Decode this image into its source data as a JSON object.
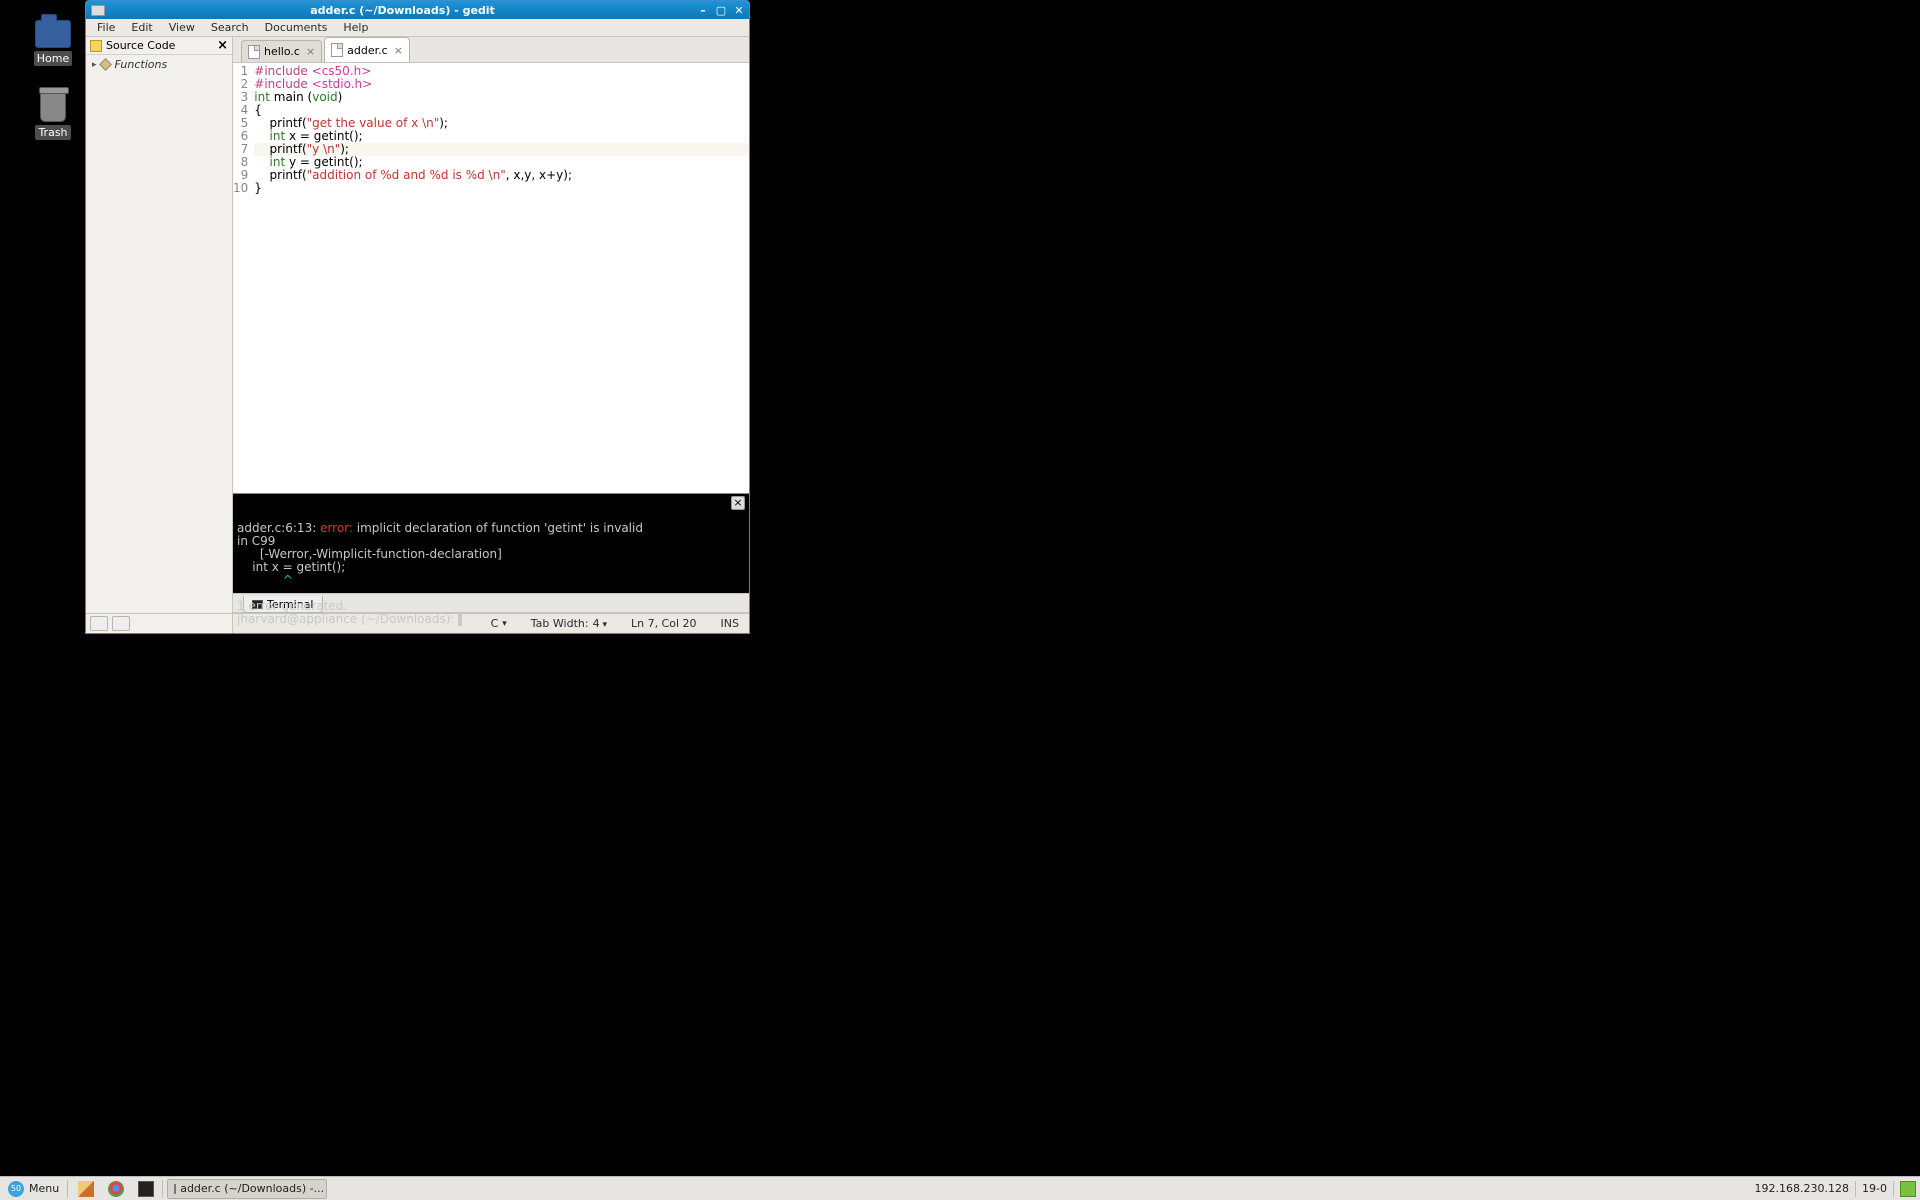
{
  "desktop": {
    "icons": [
      {
        "label": "Home"
      },
      {
        "label": "Trash"
      }
    ]
  },
  "window": {
    "title": "adder.c (~/Downloads) - gedit",
    "menus": [
      "File",
      "Edit",
      "View",
      "Search",
      "Documents",
      "Help"
    ]
  },
  "sidebar": {
    "title": "Source Code",
    "functions": "Functions"
  },
  "tabs": [
    {
      "label": "hello.c",
      "active": false
    },
    {
      "label": "adder.c",
      "active": true
    }
  ],
  "code": {
    "lines": [
      {
        "n": "1",
        "html": [
          {
            "c": "pre",
            "t": "#include"
          },
          {
            "c": "",
            "t": " "
          },
          {
            "c": "inc",
            "t": "<cs50.h>"
          }
        ]
      },
      {
        "n": "2",
        "html": [
          {
            "c": "pre",
            "t": "#include"
          },
          {
            "c": "",
            "t": " "
          },
          {
            "c": "inc",
            "t": "<stdio.h>"
          }
        ]
      },
      {
        "n": "3",
        "html": [
          {
            "c": "kw",
            "t": "int"
          },
          {
            "c": "",
            "t": " main ("
          },
          {
            "c": "kw",
            "t": "void"
          },
          {
            "c": "",
            "t": ")"
          }
        ]
      },
      {
        "n": "4",
        "html": [
          {
            "c": "",
            "t": "{"
          }
        ]
      },
      {
        "n": "5",
        "html": [
          {
            "c": "",
            "t": "    printf("
          },
          {
            "c": "str",
            "t": "\"get the value of x \\n\""
          },
          {
            "c": "",
            "t": ");"
          }
        ]
      },
      {
        "n": "6",
        "html": [
          {
            "c": "",
            "t": "    "
          },
          {
            "c": "kw",
            "t": "int"
          },
          {
            "c": "",
            "t": " x = getint();"
          }
        ]
      },
      {
        "n": "7",
        "cur": true,
        "html": [
          {
            "c": "",
            "t": "    printf("
          },
          {
            "c": "str",
            "t": "\"y \\n\""
          },
          {
            "c": "",
            "t": ");"
          }
        ]
      },
      {
        "n": "8",
        "html": [
          {
            "c": "",
            "t": "    "
          },
          {
            "c": "kw",
            "t": "int"
          },
          {
            "c": "",
            "t": " y = getint();"
          }
        ]
      },
      {
        "n": "9",
        "html": [
          {
            "c": "",
            "t": "    printf("
          },
          {
            "c": "str",
            "t": "\"addition of %d and %d is %d \\n\""
          },
          {
            "c": "",
            "t": ", x,y, x+y);"
          }
        ]
      },
      {
        "n": "10",
        "html": [
          {
            "c": "",
            "t": "}"
          }
        ]
      }
    ]
  },
  "terminal": {
    "tab": "Terminal",
    "text1a": "adder.c:6:13: ",
    "text1err": "error:",
    "text1b": " implicit declaration of function 'getint' is invalid",
    "text2": "in C99",
    "text3": "      [-Werror,-Wimplicit-function-declaration]",
    "text4": "    int x = getint();",
    "caret": "            ^",
    "text5": "1 error generated.",
    "prompt": "jharvard@appliance (~/Downloads): "
  },
  "status": {
    "lang": "C",
    "tab_label": "Tab Width:",
    "tab_width": "4",
    "pos": "Ln 7, Col 20",
    "ins": "INS"
  },
  "taskbar": {
    "menu": "Menu",
    "window": "adder.c (~/Downloads) -...",
    "ip": "192.168.230.128",
    "display": "19-0"
  }
}
